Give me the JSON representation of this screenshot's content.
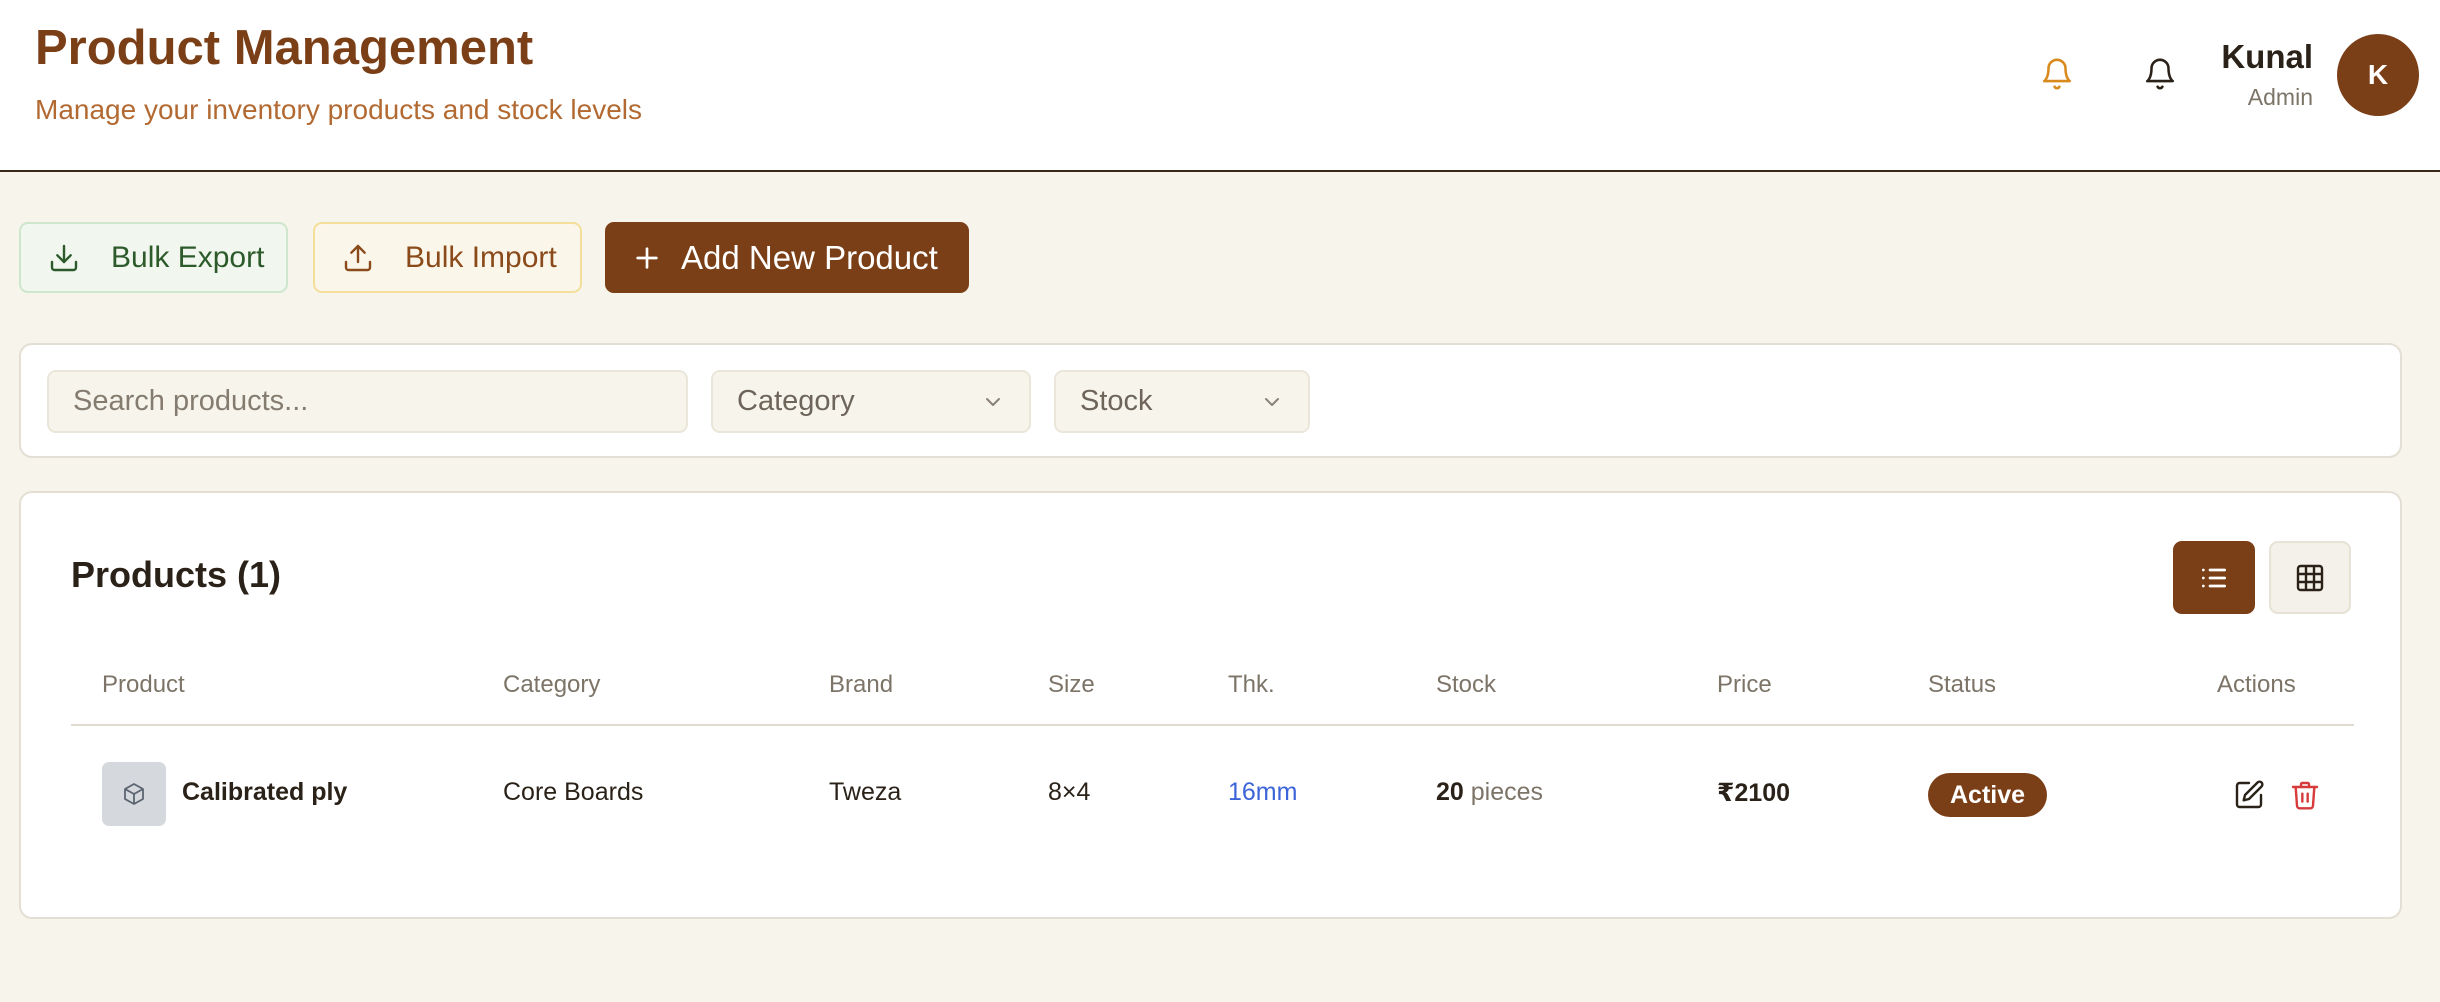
{
  "header": {
    "title": "Product Management",
    "subtitle": "Manage your inventory products and stock levels",
    "user": {
      "name": "Kunal",
      "role": "Admin",
      "initial": "K"
    }
  },
  "toolbar": {
    "export_label": "Bulk Export",
    "import_label": "Bulk Import",
    "add_label": "Add New Product"
  },
  "filters": {
    "search_placeholder": "Search products...",
    "search_value": "",
    "category_label": "Category",
    "stock_label": "Stock"
  },
  "products": {
    "title": "Products (1)",
    "columns": [
      "Product",
      "Category",
      "Brand",
      "Size",
      "Thk.",
      "Stock",
      "Price",
      "Status",
      "Actions"
    ],
    "rows": [
      {
        "name": "Calibrated ply",
        "category": "Core Boards",
        "brand": "Tweza",
        "size": "8×4",
        "thickness": "16mm",
        "stock_qty": "20",
        "stock_unit": "pieces",
        "price": "₹2100",
        "status": "Active"
      }
    ]
  },
  "colors": {
    "brand": "#7b3f17",
    "background": "#f7f4ec",
    "bell_alert": "#d98a1c",
    "thickness_link": "#3b64d9",
    "delete": "#d63a3a"
  }
}
